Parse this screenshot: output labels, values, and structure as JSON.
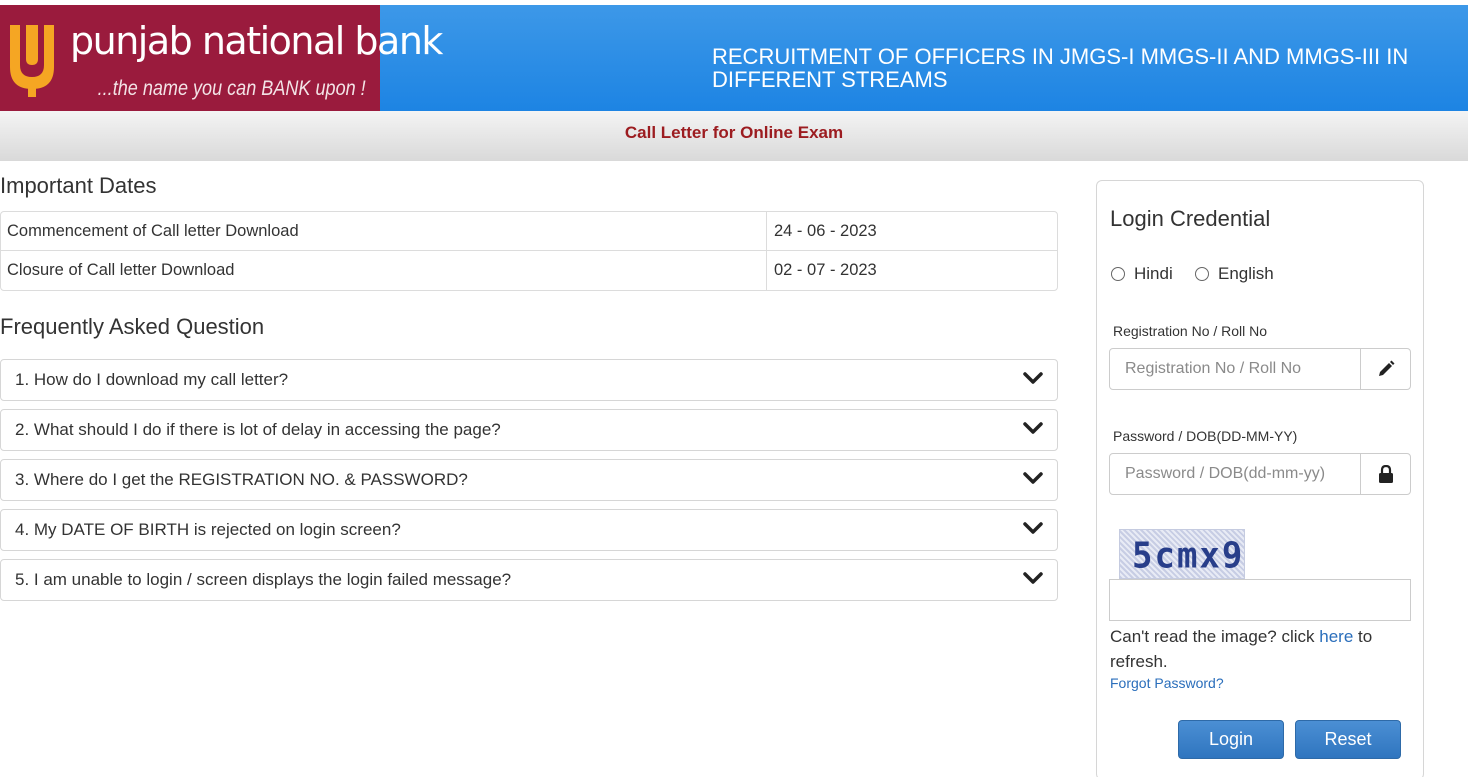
{
  "header": {
    "logo_name": "punjab national bank",
    "logo_tagline": "...the name you can BANK upon !",
    "title": "RECRUITMENT OF OFFICERS IN JMGS-I MMGS-II AND MMGS-III IN DIFFERENT STREAMS",
    "brand_color": "#9a1b3d",
    "header_color": "#1d84e3"
  },
  "subheader": {
    "title": "Call Letter for Online Exam"
  },
  "important_dates": {
    "title": "Important Dates",
    "rows": [
      {
        "label": "Commencement of Call letter Download",
        "value": "24 - 06 - 2023"
      },
      {
        "label": "Closure of Call letter Download",
        "value": "02 - 07 - 2023"
      }
    ]
  },
  "faq": {
    "title": "Frequently Asked Question",
    "items": [
      {
        "question": "1. How do I download my call letter?"
      },
      {
        "question": "2. What should I do if there is lot of delay in accessing the page?"
      },
      {
        "question": "3. Where do I get the REGISTRATION NO. & PASSWORD?"
      },
      {
        "question": "4. My DATE OF BIRTH is rejected on login screen?"
      },
      {
        "question": "5. I am unable to login / screen displays the login failed message?"
      }
    ]
  },
  "login": {
    "title": "Login Credential",
    "languages": [
      "Hindi",
      "English"
    ],
    "registration_label": "Registration No / Roll No",
    "registration_placeholder": "Registration No / Roll No",
    "password_label": "Password / DOB(DD-MM-YY)",
    "password_placeholder": "Password / DOB(dd-mm-yy)",
    "captcha_text": "5cmx9",
    "help_prefix": "Can't read the image? click ",
    "help_link": "here",
    "help_suffix": " to refresh.",
    "forgot_password": "Forgot Password?",
    "login_button": "Login",
    "reset_button": "Reset",
    "button_color": "#2f75bf"
  }
}
